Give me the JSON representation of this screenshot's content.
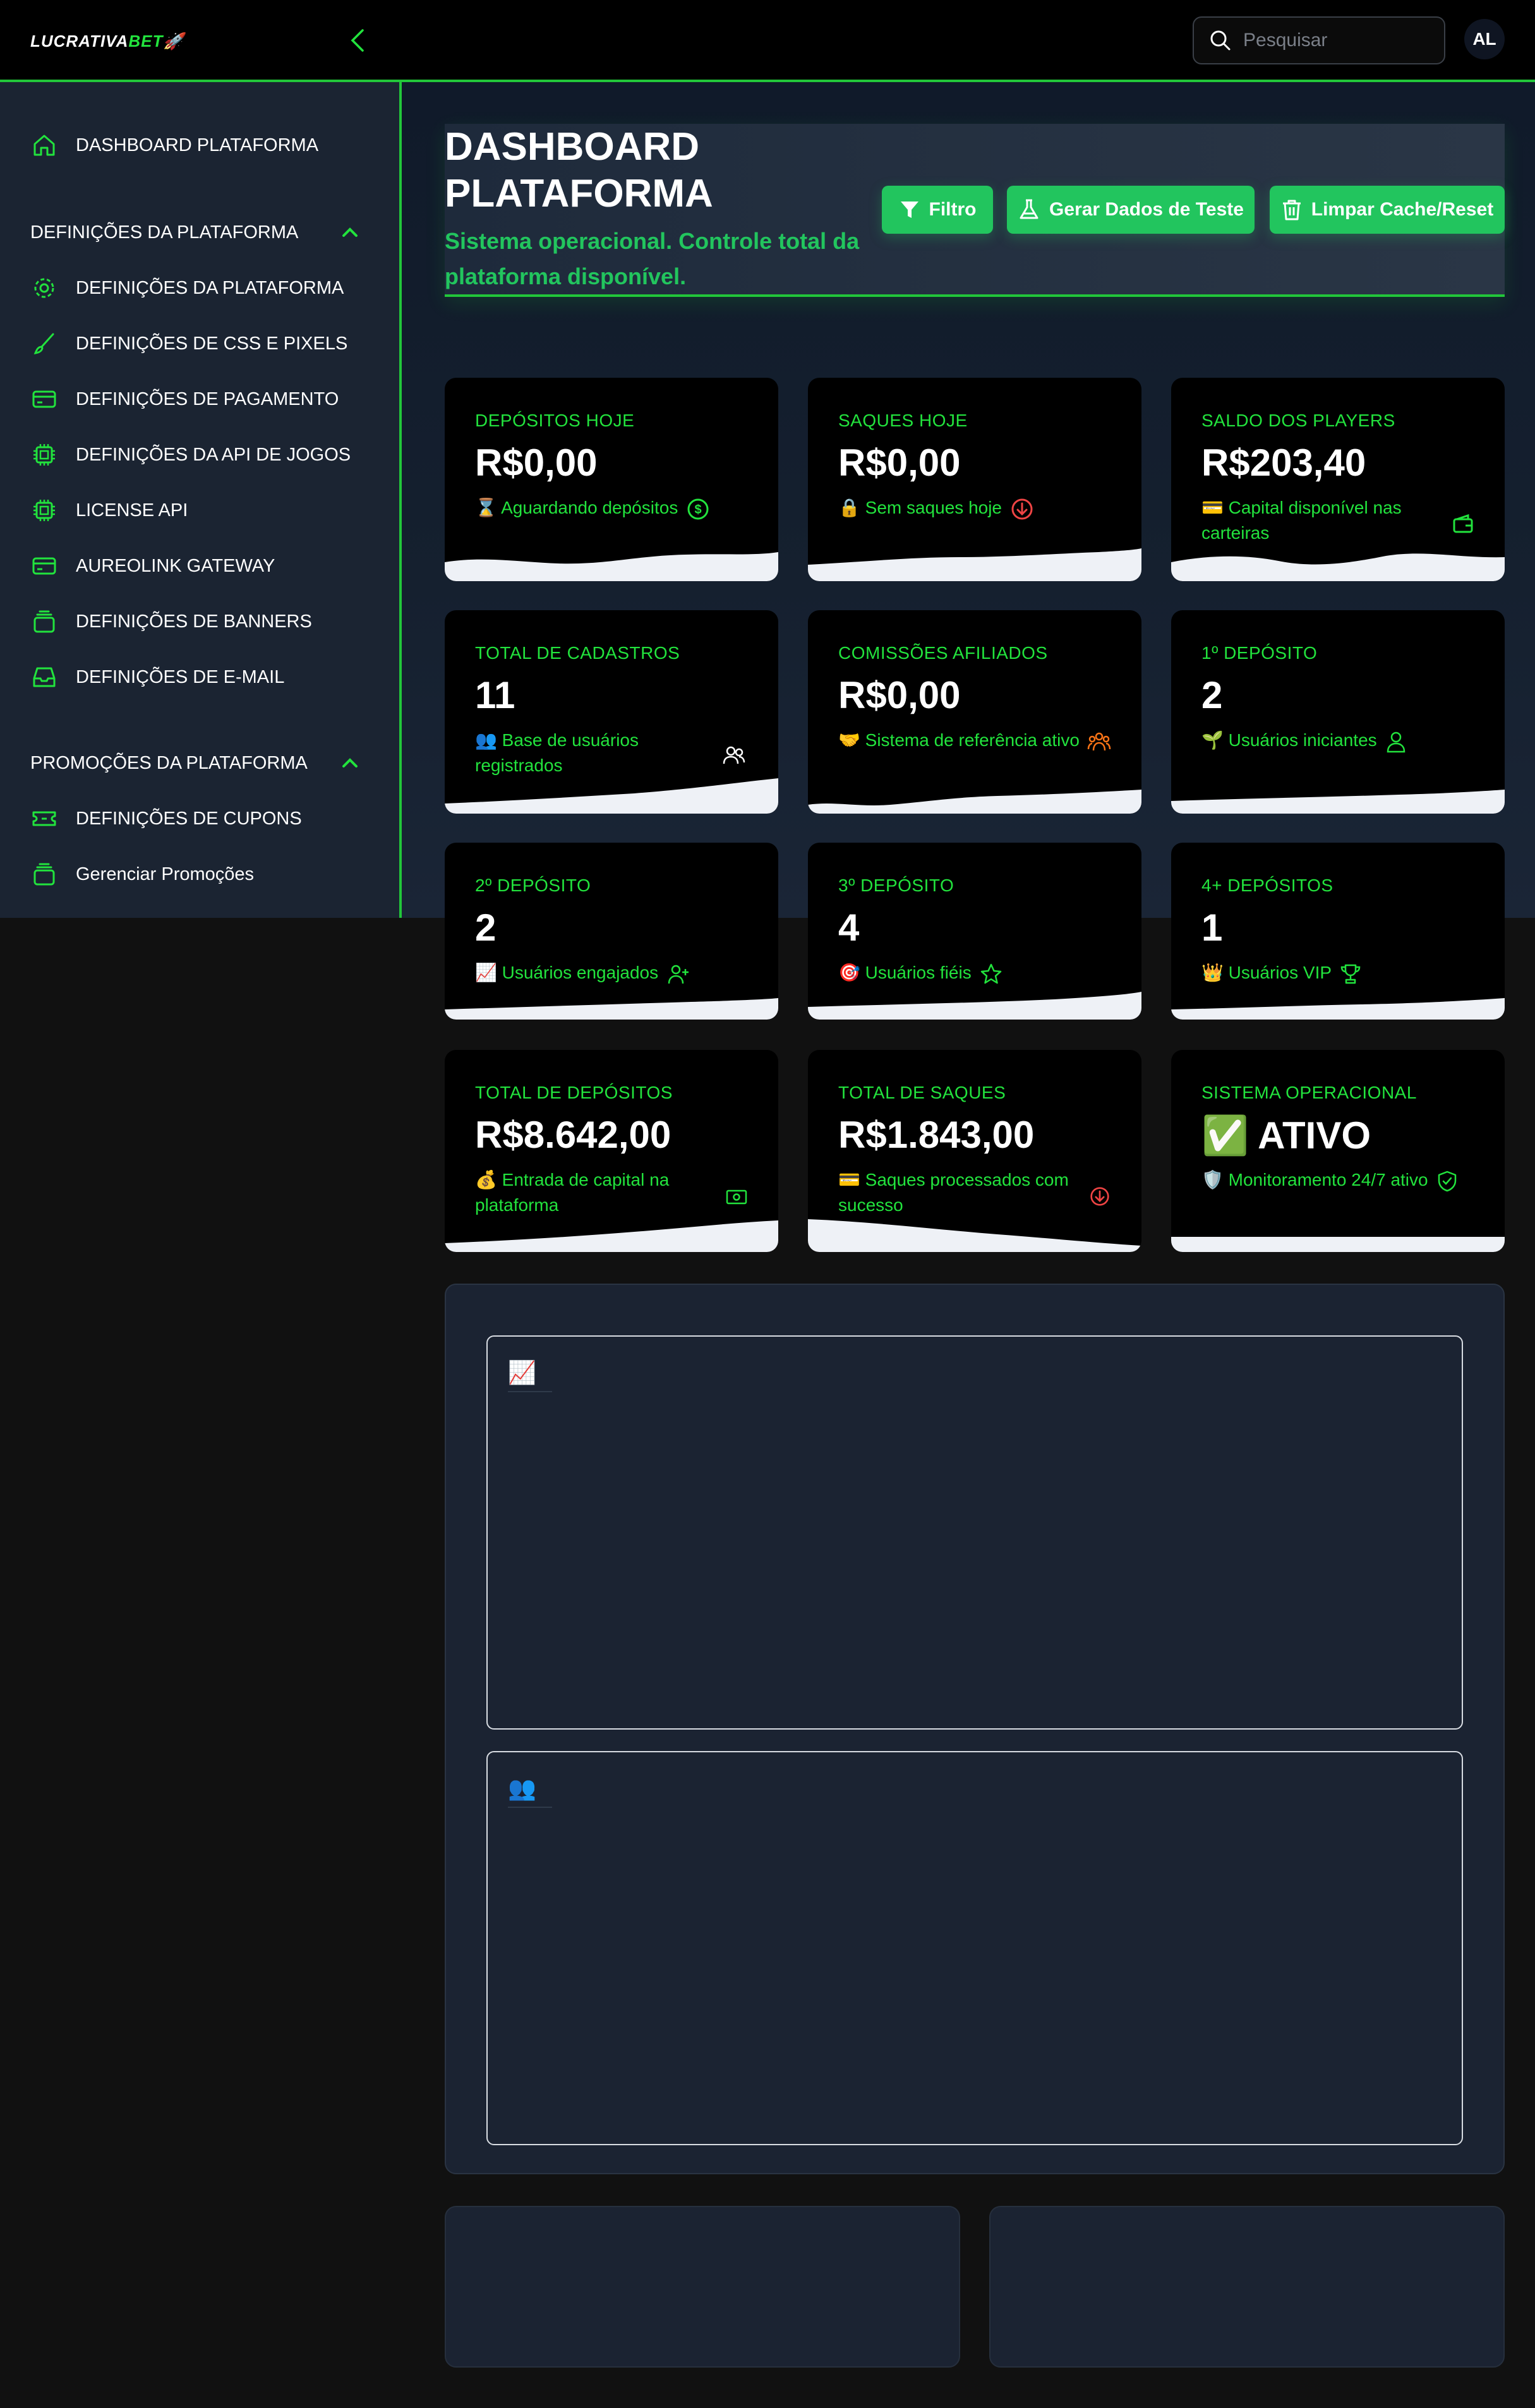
{
  "header": {
    "logo_primary": "LUCRATIVA",
    "logo_accent": "BET",
    "logo_emoji": "🚀",
    "search_placeholder": "Pesquisar",
    "avatar_initials": "AL"
  },
  "sidebar": {
    "dashboard": "DASHBOARD PLATAFORMA",
    "section_platform": "DEFINIÇÕES DA PLATAFORMA",
    "platform_items": [
      {
        "label": "DEFINIÇÕES DA PLATAFORMA",
        "icon": "gear-icon"
      },
      {
        "label": "DEFINIÇÕES DE CSS E PIXELS",
        "icon": "brush-icon"
      },
      {
        "label": "DEFINIÇÕES DE PAGAMENTO",
        "icon": "credit-card-icon"
      },
      {
        "label": "DEFINIÇÕES DA API DE JOGOS",
        "icon": "chip-icon"
      },
      {
        "label": "LICENSE API",
        "icon": "chip-icon"
      },
      {
        "label": "AUREOLINK GATEWAY",
        "icon": "credit-card-icon"
      },
      {
        "label": "DEFINIÇÕES DE BANNERS",
        "icon": "image-stack-icon"
      },
      {
        "label": "DEFINIÇÕES DE E-MAIL",
        "icon": "inbox-icon"
      }
    ],
    "section_promotions": "PROMOÇÕES DA PLATAFORMA",
    "promo_items": [
      {
        "label": "DEFINIÇÕES DE CUPONS",
        "icon": "ticket-icon"
      },
      {
        "label": "Gerenciar Promoções",
        "icon": "image-stack-icon"
      }
    ]
  },
  "hero": {
    "title": "DASHBOARD PLATAFORMA",
    "subtitle": "Sistema operacional. Controle total da plataforma disponível.",
    "btn_filter": "Filtro",
    "btn_test": "Gerar Dados de Teste",
    "btn_clear": "Limpar Cache/Reset"
  },
  "stats": [
    {
      "label": "DEPÓSITOS HOJE",
      "value": "R$0,00",
      "desc": "⌛ Aguardando depósitos",
      "icon": "dollar-circle-icon"
    },
    {
      "label": "SAQUES HOJE",
      "value": "R$0,00",
      "desc": "🔒 Sem saques hoje",
      "icon": "arrow-down-circle-icon"
    },
    {
      "label": "SALDO DOS PLAYERS",
      "value": "R$203,40",
      "desc": "💳 Capital disponível nas carteiras",
      "icon": "wallet-icon"
    },
    {
      "label": "TOTAL DE CADASTROS",
      "value": "11",
      "desc": "👥 Base de usuários registrados",
      "icon": "users-icon"
    },
    {
      "label": "COMISSÕES AFILIADOS",
      "value": "R$0,00",
      "desc": "🤝 Sistema de referência ativo",
      "icon": "group-icon"
    },
    {
      "label": "1º DEPÓSITO",
      "value": "2",
      "desc": "🌱 Usuários iniciantes",
      "icon": "user-icon"
    },
    {
      "label": "2º DEPÓSITO",
      "value": "2",
      "desc": "📈 Usuários engajados",
      "icon": "user-plus-icon"
    },
    {
      "label": "3º DEPÓSITO",
      "value": "4",
      "desc": "🎯 Usuários fiéis",
      "icon": "star-icon"
    },
    {
      "label": "4+ DEPÓSITOS",
      "value": "1",
      "desc": "👑 Usuários VIP",
      "icon": "trophy-icon"
    },
    {
      "label": "TOTAL DE DEPÓSITOS",
      "value": "R$8.642,00",
      "desc": "💰 Entrada de capital na plataforma",
      "icon": "cash-icon"
    },
    {
      "label": "TOTAL DE SAQUES",
      "value": "R$1.843,00",
      "desc": "💳 Saques processados com sucesso",
      "icon": "arrow-down-circle-icon"
    },
    {
      "label": "SISTEMA OPERACIONAL",
      "value": "✅ ATIVO",
      "desc": "🛡️ Monitoramento 24/7 ativo",
      "icon": "shield-check-icon"
    }
  ],
  "charts": {
    "chart1_emoji": "📈",
    "chart2_emoji": "👥"
  },
  "colors": {
    "accent": "#22e33d",
    "button": "#22c55e",
    "danger": "#ef4444",
    "orange": "#f97316"
  }
}
